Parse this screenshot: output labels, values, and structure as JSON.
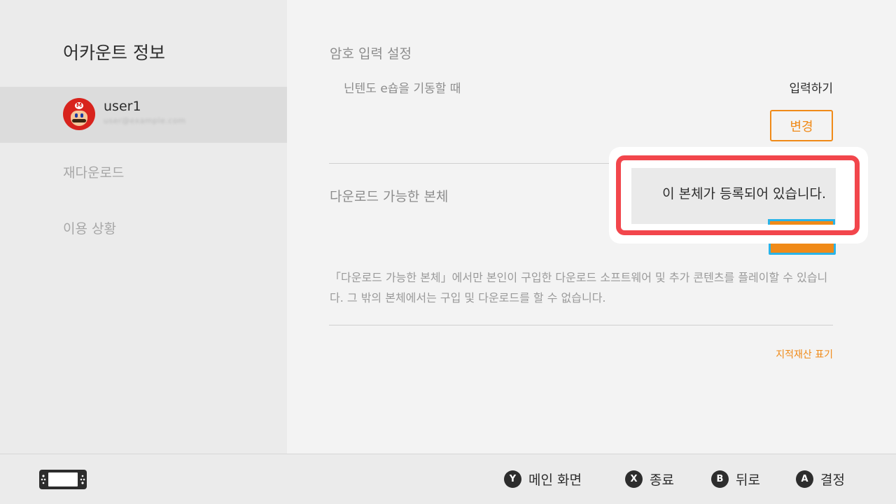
{
  "sidebar": {
    "title": "어카운트 정보",
    "user": {
      "name": "user1",
      "email": "user@example.com"
    },
    "items": [
      {
        "label": "재다운로드"
      },
      {
        "label": "이용 상황"
      }
    ]
  },
  "password_section": {
    "title": "암호 입력 설정",
    "row_label": "닌텐도 e숍을 기동할 때",
    "row_value": "입력하기",
    "change_button": "변경"
  },
  "download_section": {
    "title": "다운로드 가능한 본체",
    "description": "「다운로드 가능한 본체」에서만 본인이 구입한 다운로드 소프트웨어 및 추가 콘텐츠를 플레이할 수 있습니다.  그 밖의 본체에서는 구입 및 다운로드를 할 수 없습니다."
  },
  "popup": {
    "text": "이 본체가 등록되어 있습니다."
  },
  "ip_link": "지적재산 표기",
  "footer": {
    "hints": [
      {
        "button": "Y",
        "label": "메인 화면"
      },
      {
        "button": "X",
        "label": "종료"
      },
      {
        "button": "B",
        "label": "뒤로"
      },
      {
        "button": "A",
        "label": "결정"
      }
    ]
  },
  "colors": {
    "accent": "#f08a18",
    "highlight": "#f2464c",
    "focus": "#2ab4e8"
  }
}
